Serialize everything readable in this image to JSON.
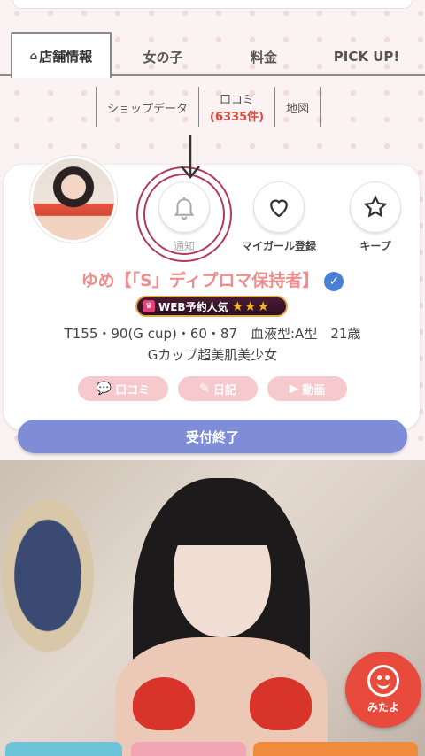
{
  "tabs": [
    {
      "label": "店舗情報",
      "icon": "home-icon",
      "active": true
    },
    {
      "label": "女の子"
    },
    {
      "label": "料金"
    },
    {
      "label": "PICK UP!"
    }
  ],
  "subnav": {
    "shop_data": "ショップデータ",
    "reviews": "口コミ",
    "reviews_count": "(6335件)",
    "map": "地図"
  },
  "actions": {
    "notify": "通知",
    "my_girl": "マイガール登録",
    "keep": "キープ"
  },
  "profile": {
    "name": "ゆめ【「S」ディプロマ保持者】",
    "badge_text": "WEB予約人気",
    "badge_stars": "★★★",
    "stats": "T155・90(G cup)・60・87　血液型:A型　21歳",
    "tagline": "Gカップ超美肌美少女"
  },
  "buttons": {
    "reviews": "口コミ",
    "diary": "日記",
    "video": "動画",
    "reserve": "受付終了",
    "mitayo": "みたよ"
  },
  "colors": {
    "name": "#ef8d8d",
    "reserve": "#7f8cd6",
    "pill": "#f6c9cc",
    "mitayo": "#e84a3c",
    "annotation": "#b23a5a"
  }
}
